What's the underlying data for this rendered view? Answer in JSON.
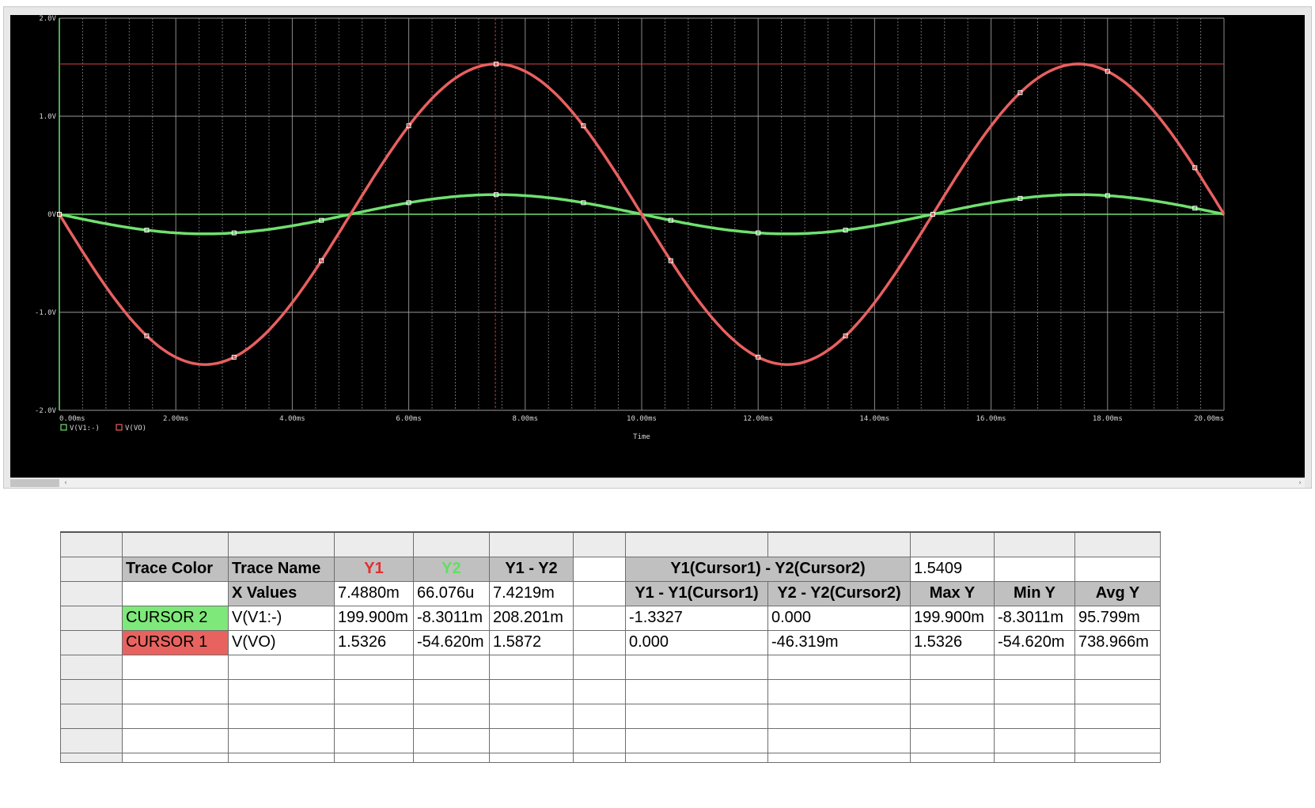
{
  "plot": {
    "y_ticks": [
      "2.0V",
      "1.0V",
      "0V",
      "-1.0V",
      "-2.0V"
    ],
    "x_ticks": [
      "0.00ms",
      "2.00ms",
      "4.00ms",
      "6.00ms",
      "8.00ms",
      "10.00ms",
      "12.00ms",
      "14.00ms",
      "16.00ms",
      "18.00ms",
      "20.00ms"
    ],
    "xlabel": "Time",
    "legend": [
      "V(V1:-)",
      "V(VO)"
    ],
    "cursor_level_v": 1.5326,
    "cursor_time_ms": 7.488,
    "colors": {
      "background": "#000000",
      "grid": "#9a9a9a",
      "vo": "#e86060",
      "v1": "#70e070",
      "cursor": "#c03a3a"
    }
  },
  "chart_data": {
    "type": "line",
    "xlabel": "Time",
    "ylabel": "",
    "xlim": [
      0,
      20
    ],
    "ylim": [
      -2.0,
      2.0
    ],
    "grid": true,
    "legend_position": "bottom-left",
    "x": [
      0,
      0.5,
      1,
      1.5,
      2,
      2.5,
      3,
      3.5,
      4,
      4.5,
      5,
      5.5,
      6,
      6.5,
      7,
      7.5,
      8,
      8.5,
      9,
      9.5,
      10,
      10.5,
      11,
      11.5,
      12,
      12.5,
      13,
      13.5,
      14,
      14.5,
      15,
      15.5,
      16,
      16.5,
      17,
      17.5,
      18,
      18.5,
      19,
      19.5,
      20
    ],
    "series": [
      {
        "name": "V(V1:-)",
        "color": "#70e070",
        "values": [
          0,
          -0.062,
          -0.118,
          -0.162,
          -0.19,
          -0.2,
          -0.19,
          -0.162,
          -0.118,
          -0.062,
          0,
          0.062,
          0.118,
          0.162,
          0.19,
          0.2,
          0.19,
          0.162,
          0.118,
          0.062,
          0,
          -0.062,
          -0.118,
          -0.162,
          -0.19,
          -0.2,
          -0.19,
          -0.162,
          -0.118,
          -0.062,
          0,
          0.062,
          0.118,
          0.162,
          0.19,
          0.2,
          0.19,
          0.162,
          0.118,
          0.062,
          0
        ]
      },
      {
        "name": "V(VO)",
        "color": "#e86060",
        "values": [
          0,
          -0.474,
          -0.902,
          -1.24,
          -1.458,
          -1.533,
          -1.458,
          -1.24,
          -0.902,
          -0.474,
          0,
          0.474,
          0.902,
          1.24,
          1.458,
          1.533,
          1.458,
          1.24,
          0.902,
          0.474,
          0,
          -0.474,
          -0.902,
          -1.24,
          -1.458,
          -1.533,
          -1.458,
          -1.24,
          -0.902,
          -0.474,
          0,
          0.474,
          0.902,
          1.24,
          1.458,
          1.533,
          1.458,
          1.24,
          0.902,
          0.474,
          0
        ]
      }
    ]
  },
  "table": {
    "header_row": [
      "Trace Color",
      "Trace Name",
      "Y1",
      "Y2",
      "Y1 - Y2",
      "",
      "Y1(Cursor1) - Y2(Cursor2)",
      "1.5409",
      "",
      ""
    ],
    "header_colors": {
      "y1": "#e03030",
      "y2": "#60e060"
    },
    "xvalues_row": [
      "",
      "X Values",
      "7.4880m",
      "66.076u",
      "7.4219m",
      "",
      "Y1 - Y1(Cursor1)",
      "Y2 - Y2(Cursor2)",
      "Max Y",
      "Min Y",
      "Avg Y"
    ],
    "rows": [
      [
        "CURSOR 2",
        "V(V1:-)",
        "199.900m",
        "-8.3011m",
        "208.201m",
        "",
        "-1.3327",
        "0.000",
        "199.900m",
        "-8.3011m",
        "95.799m"
      ],
      [
        "CURSOR 1",
        "V(VO)",
        "1.5326",
        "-54.620m",
        "1.5872",
        "",
        "0.000",
        "-46.319m",
        "1.5326",
        "-54.620m",
        "738.966m"
      ]
    ]
  }
}
